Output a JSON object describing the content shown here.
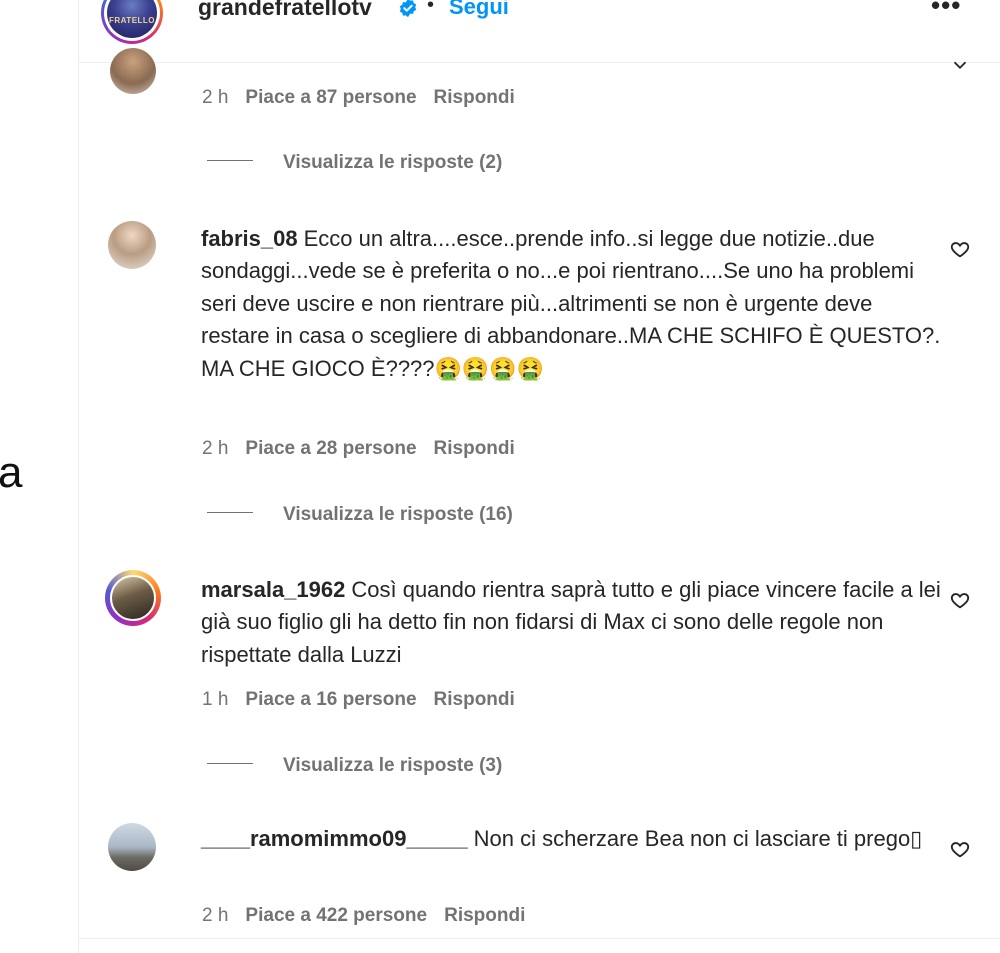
{
  "left": {
    "partial_text": "a"
  },
  "header": {
    "username": "grandefratellotv",
    "avatar_text": "FRATELLO",
    "separator": "•",
    "follow_label": "Segui",
    "more_label": "•••"
  },
  "top_comment": {
    "time": "2 h",
    "likes": "Piace a 87 persone",
    "reply": "Rispondi",
    "view_replies": "Visualizza le risposte (2)"
  },
  "comments": [
    {
      "username": "fabris_08",
      "text": "Ecco un altra....esce..prende info..si legge due notizie..due sondaggi...vede se è preferita o no...e poi rientrano....Se uno ha problemi seri deve uscire e non rientrare più...altrimenti se non è urgente deve restare in casa o scegliere di abbandonare..MA CHE SCHIFO È QUESTO?. MA CHE GIOCO È????🤮🤮🤮🤮",
      "time": "2 h",
      "likes": "Piace a 28 persone",
      "reply": "Rispondi",
      "view_replies": "Visualizza le risposte (16)"
    },
    {
      "username": "marsala_1962",
      "text": "Così quando rientra saprà tutto e gli piace vincere facile a lei già suo figlio gli ha detto fin non fidarsi di Max ci sono delle regole non rispettate dalla Luzzi",
      "time": "1 h",
      "likes": "Piace a 16 persone",
      "reply": "Rispondi",
      "view_replies": "Visualizza le risposte (3)"
    },
    {
      "username": "____ramomimmo09_____",
      "text": "Non ci scherzare Bea non ci lasciare ti prego▯",
      "time": "2 h",
      "likes": "Piace a 422 persone",
      "reply": "Rispondi"
    }
  ],
  "colors": {
    "text": "#262626",
    "secondary": "#737373",
    "link": "#0095f6",
    "verified": "#0095f6"
  },
  "icons": [
    "verified-badge-icon",
    "heart-icon",
    "more-options-icon"
  ]
}
